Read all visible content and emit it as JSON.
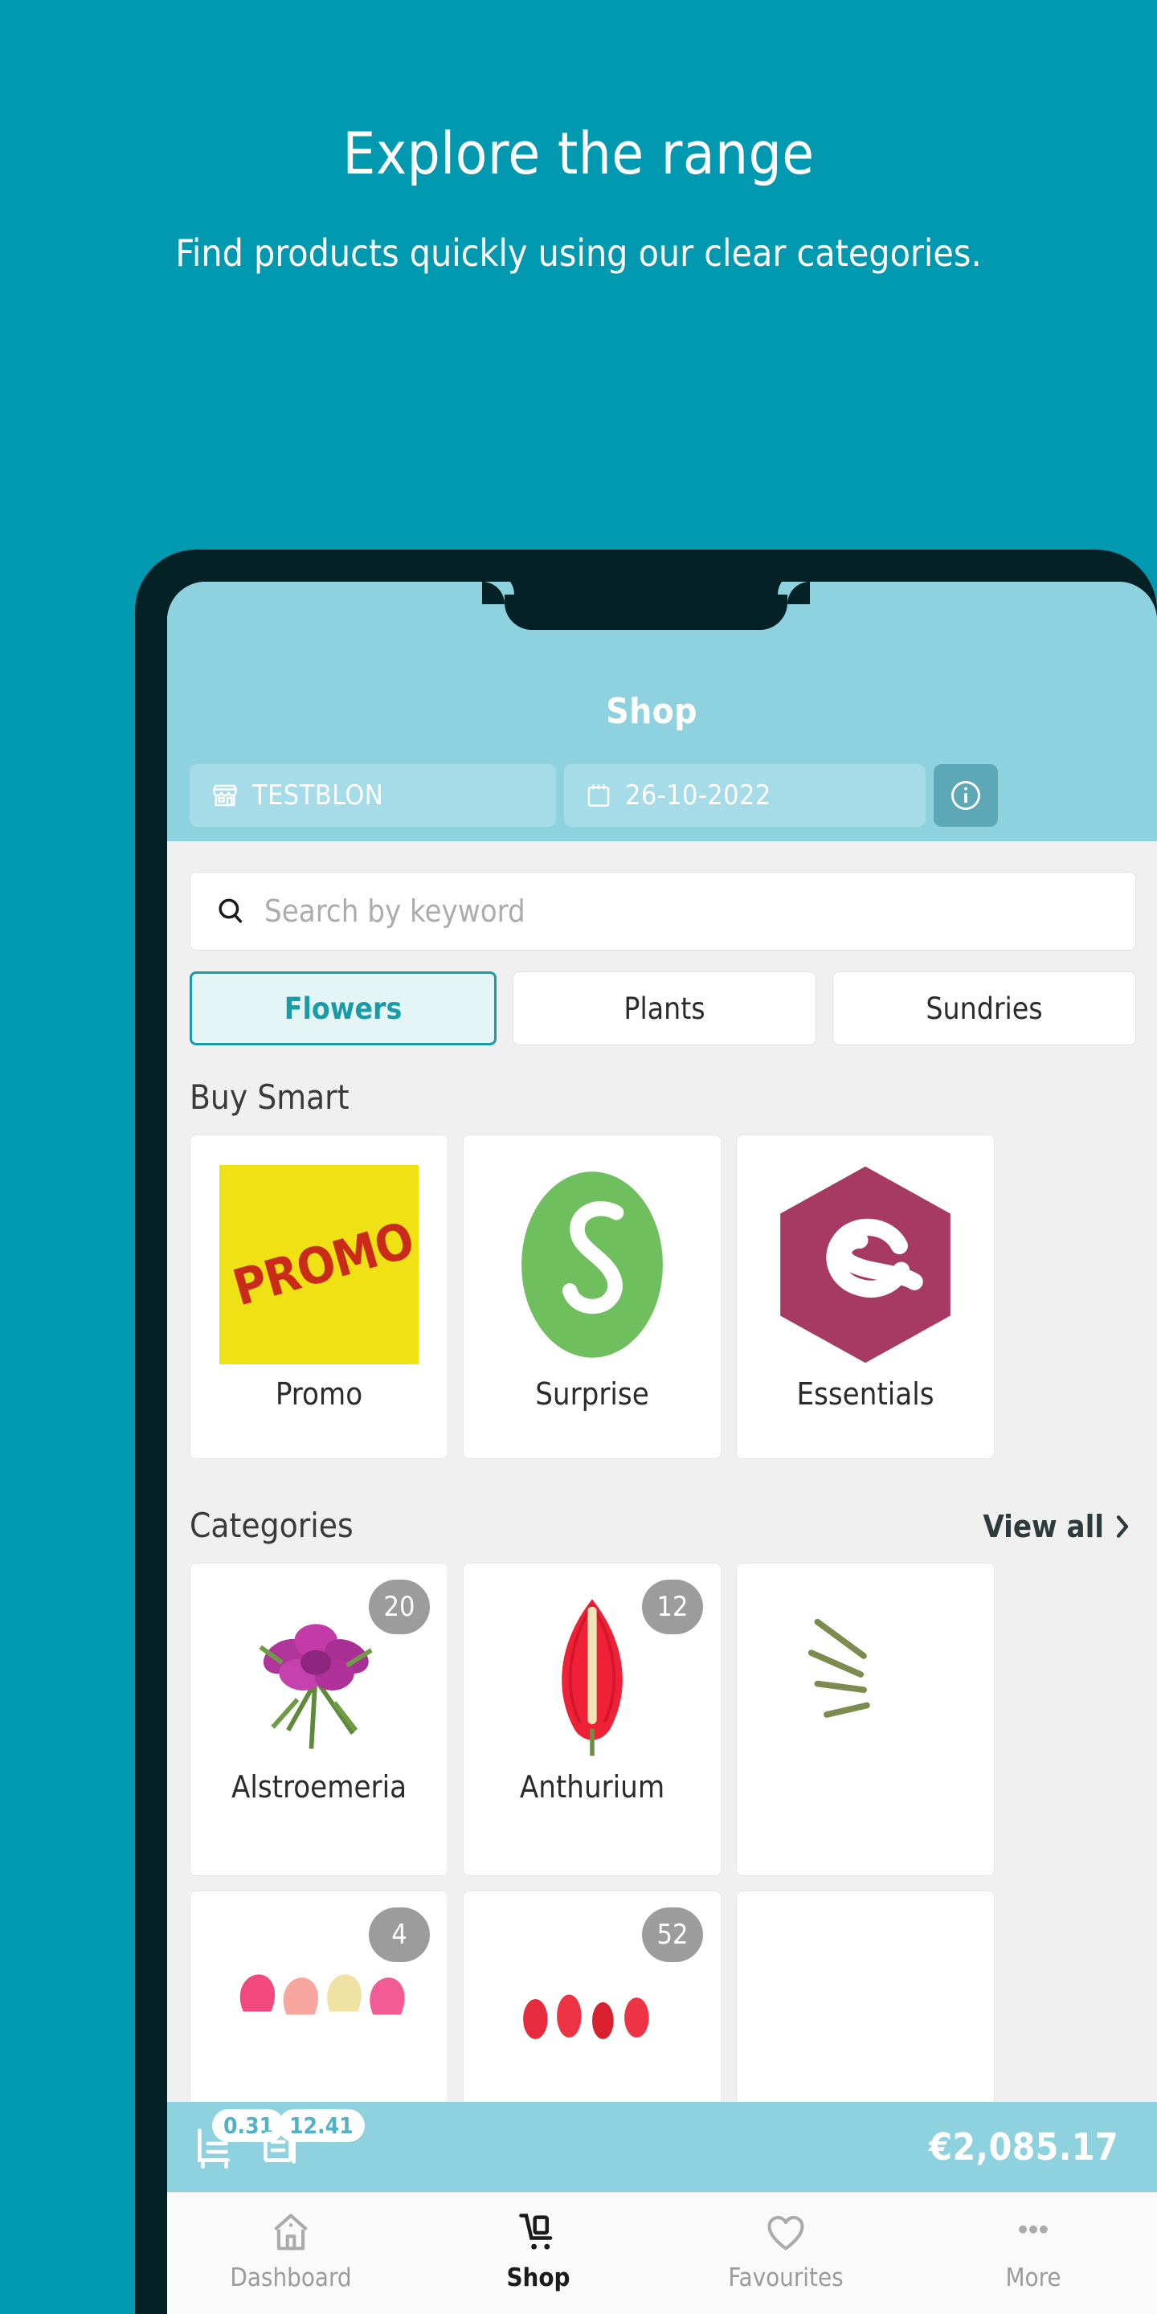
{
  "promo": {
    "headline": "Explore the range",
    "subhead": "Find products quickly using our clear categories."
  },
  "app": {
    "title": "Shop",
    "info_bar": {
      "store": {
        "icon": "storefront-icon",
        "label": "TESTBLON"
      },
      "date": {
        "icon": "calendar-icon",
        "label": "26-10-2022"
      },
      "info_button": {
        "icon": "info-circle-icon",
        "label": "i"
      }
    },
    "search": {
      "icon": "search-icon",
      "placeholder": "Search by keyword",
      "value": ""
    },
    "tabs": [
      {
        "label": "Flowers",
        "active": true
      },
      {
        "label": "Plants",
        "active": false
      },
      {
        "label": "Sundries",
        "active": false
      }
    ],
    "buy_smart": {
      "title": "Buy Smart",
      "items": [
        {
          "label": "Promo",
          "art": "promo-tile",
          "art_text": "PROMO",
          "bg": "#EFE114",
          "fg": "#C92B18"
        },
        {
          "label": "Surprise",
          "art": "surprise-logo",
          "color": "#6FBF5E"
        },
        {
          "label": "Essentials",
          "art": "essentials-logo",
          "color": "#A63A63"
        }
      ]
    },
    "categories": {
      "title": "Categories",
      "view_all": "View all",
      "view_all_icon": "chevron-right-icon",
      "items": [
        {
          "name": "Alstroemeria",
          "count": "20",
          "art": "alstroemeria-photo"
        },
        {
          "name": "Anthurium",
          "count": "12",
          "art": "anthurium-photo"
        },
        {
          "name": "",
          "count": "",
          "art": "greenery-photo"
        },
        {
          "name": "",
          "count": "4",
          "art": "tulips-photo"
        },
        {
          "name": "",
          "count": "52",
          "art": "roses-photo"
        },
        {
          "name": "",
          "count": "",
          "art": "blank-photo"
        }
      ]
    },
    "cart_bar": {
      "stats": [
        {
          "icon": "trolley-icon",
          "value": "0.31"
        },
        {
          "icon": "stacked-boxes-icon",
          "value": "12.41"
        }
      ],
      "total": "€2,085.17"
    },
    "bottom_nav": [
      {
        "label": "Dashboard",
        "icon": "home-icon",
        "active": false
      },
      {
        "label": "Shop",
        "icon": "cart-icon",
        "active": true
      },
      {
        "label": "Favourites",
        "icon": "heart-icon",
        "active": false
      },
      {
        "label": "More",
        "icon": "ellipsis-icon",
        "active": false
      }
    ]
  },
  "colors": {
    "brand_teal": "#0099AF",
    "header_blue": "#8ED2E0",
    "accent": "#1A9CA8",
    "frame": "#042226",
    "badge_gray": "#9C9C9C"
  }
}
